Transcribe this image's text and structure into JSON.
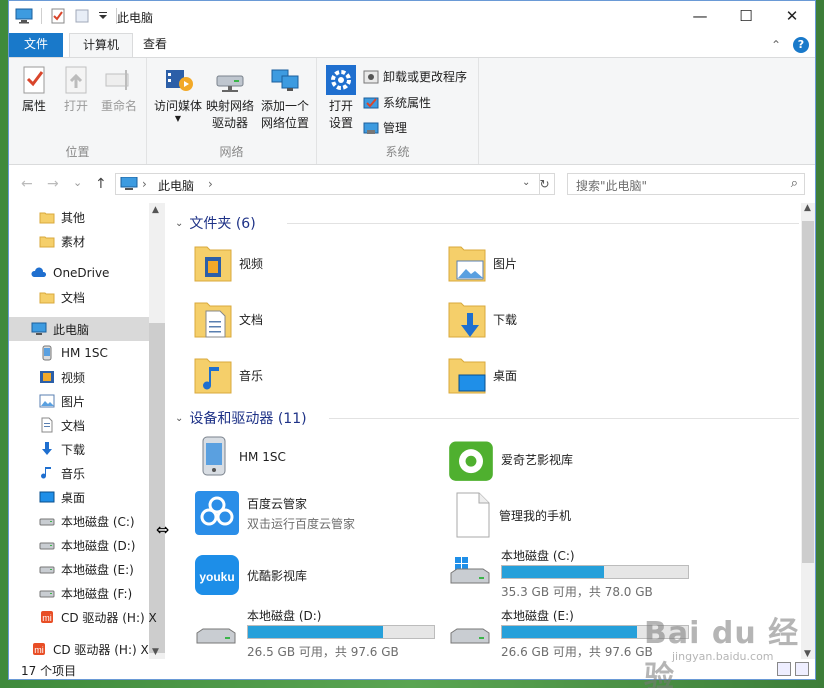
{
  "window": {
    "title": "此电脑",
    "min": "—",
    "max": "☐",
    "close": "✕"
  },
  "tabs": {
    "file": "文件",
    "computer": "计算机",
    "view": "查看",
    "help": "?",
    "collapse": "⌃"
  },
  "ribbon": {
    "location": {
      "label": "位置",
      "properties": "属性",
      "open": "打开",
      "rename": "重命名"
    },
    "network": {
      "label": "网络",
      "media_1": "访问媒体",
      "map_1": "映射网络",
      "map_2": "驱动器",
      "add_1": "添加一个",
      "add_2": "网络位置"
    },
    "system": {
      "label": "系统",
      "open_1": "打开",
      "open_2": "设置",
      "uninstall": "卸载或更改程序",
      "sysprops": "系统属性",
      "manage": "管理"
    }
  },
  "address": {
    "back": "←",
    "forward": "→",
    "recent": "⌄",
    "up": "↑",
    "crumb": "此电脑",
    "sep": "›",
    "refresh": "↻",
    "search_placeholder": "搜索\"此电脑\"",
    "search_icon": "search-icon"
  },
  "nav": {
    "items": [
      {
        "label": "其他",
        "icon": "folder-icon"
      },
      {
        "label": "素材",
        "icon": "folder-icon"
      },
      {
        "label": "OneDrive",
        "icon": "cloud-icon"
      },
      {
        "label": "文档",
        "icon": "folder-icon"
      },
      {
        "label": "此电脑",
        "icon": "computer-icon"
      },
      {
        "label": "HM 1SC",
        "icon": "phone-icon"
      },
      {
        "label": "视频",
        "icon": "video-icon"
      },
      {
        "label": "图片",
        "icon": "picture-icon"
      },
      {
        "label": "文档",
        "icon": "document-icon"
      },
      {
        "label": "下载",
        "icon": "download-icon"
      },
      {
        "label": "音乐",
        "icon": "music-icon"
      },
      {
        "label": "桌面",
        "icon": "desktop-icon"
      },
      {
        "label": "本地磁盘 (C:)",
        "icon": "drive-icon"
      },
      {
        "label": "本地磁盘 (D:)",
        "icon": "drive-icon"
      },
      {
        "label": "本地磁盘 (E:)",
        "icon": "drive-icon"
      },
      {
        "label": "本地磁盘 (F:)",
        "icon": "drive-icon"
      },
      {
        "label": "CD 驱动器 (H:) X",
        "icon": "cd-icon"
      },
      {
        "label": "CD 驱动器 (H:) X",
        "icon": "cd-icon"
      }
    ]
  },
  "folders": {
    "heading": "文件夹 (6)",
    "items": [
      {
        "label": "视频",
        "icon": "video-folder-icon"
      },
      {
        "label": "图片",
        "icon": "picture-folder-icon"
      },
      {
        "label": "文档",
        "icon": "document-folder-icon"
      },
      {
        "label": "下载",
        "icon": "download-folder-icon"
      },
      {
        "label": "音乐",
        "icon": "music-folder-icon"
      },
      {
        "label": "桌面",
        "icon": "desktop-folder-icon"
      }
    ]
  },
  "devices": {
    "heading": "设备和驱动器 (11)",
    "items": [
      {
        "label": "HM 1SC",
        "sub": ""
      },
      {
        "label": "爱奇艺影视库",
        "sub": ""
      },
      {
        "label": "百度云管家",
        "sub": "双击运行百度云管家"
      },
      {
        "label": "管理我的手机",
        "sub": ""
      },
      {
        "label": "优酷影视库",
        "sub": ""
      }
    ],
    "drives": [
      {
        "name": "本地磁盘 (C:)",
        "info": "35.3 GB 可用，共 78.0 GB",
        "used_fraction": 0.547
      },
      {
        "name": "本地磁盘 (D:)",
        "info": "26.5 GB 可用，共 97.6 GB",
        "used_fraction": 0.728
      },
      {
        "name": "本地磁盘 (E:)",
        "info": "26.6 GB 可用，共 97.6 GB",
        "used_fraction": 0.727
      }
    ]
  },
  "status": {
    "count": "17 个项目"
  },
  "watermark": {
    "brand": "Bai du 经验",
    "url": "jingyan.baidu.com"
  },
  "colors": {
    "accent": "#1979ca",
    "drive_fill": "#26a0da",
    "folder": "#f5cf6a"
  }
}
